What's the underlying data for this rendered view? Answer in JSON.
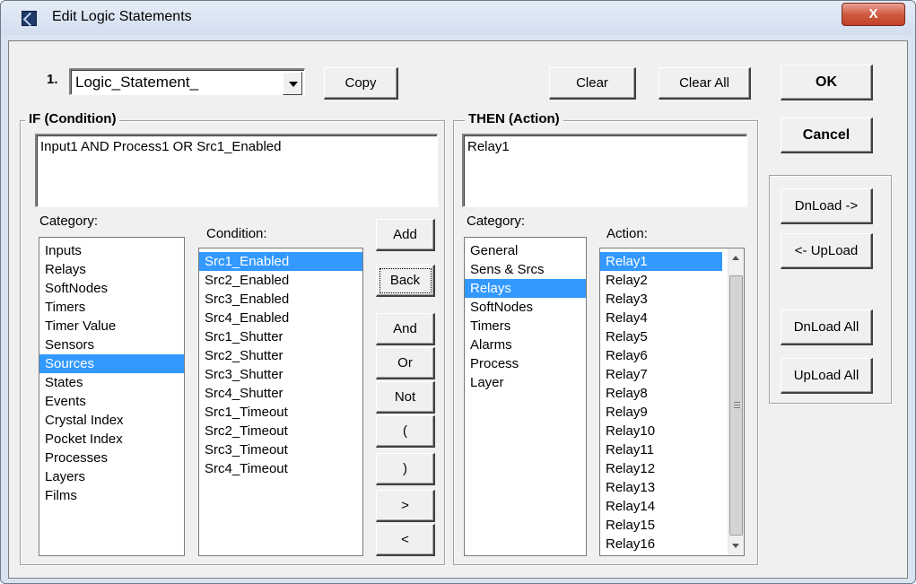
{
  "window": {
    "title": "Edit Logic Statements",
    "close_label": "X"
  },
  "top": {
    "statement_number": "1.",
    "statement_value": "Logic_Statement_",
    "copy_label": "Copy",
    "clear_label": "Clear",
    "clear_all_label": "Clear All",
    "ok_label": "OK",
    "cancel_label": "Cancel"
  },
  "if_group": {
    "legend": "IF (Condition)",
    "text": "Input1 AND Process1 OR Src1_Enabled",
    "category_label": "Category:",
    "categories": [
      "Inputs",
      "Relays",
      "SoftNodes",
      "Timers",
      "Timer Value",
      "Sensors",
      "Sources",
      "States",
      "Events",
      "Crystal Index",
      "Pocket Index",
      "Processes",
      "Layers",
      "Films"
    ],
    "category_selected": "Sources",
    "condition_label": "Condition:",
    "conditions": [
      "Src1_Enabled",
      "Src2_Enabled",
      "Src3_Enabled",
      "Src4_Enabled",
      "Src1_Shutter",
      "Src2_Shutter",
      "Src3_Shutter",
      "Src4_Shutter",
      "Src1_Timeout",
      "Src2_Timeout",
      "Src3_Timeout",
      "Src4_Timeout"
    ],
    "condition_selected": "Src1_Enabled"
  },
  "operators": {
    "add": "Add",
    "back": "Back",
    "and": "And",
    "or": "Or",
    "not": "Not",
    "open_paren": "(",
    "close_paren": ")",
    "gt": ">",
    "lt": "<"
  },
  "then_group": {
    "legend": "THEN (Action)",
    "text": "Relay1",
    "category_label": "Category:",
    "categories": [
      "General",
      "Sens & Srcs",
      "Relays",
      "SoftNodes",
      "Timers",
      "Alarms",
      "Process",
      "Layer"
    ],
    "category_selected": "Relays",
    "action_label": "Action:",
    "actions": [
      "Relay1",
      "Relay2",
      "Relay3",
      "Relay4",
      "Relay5",
      "Relay6",
      "Relay7",
      "Relay8",
      "Relay9",
      "Relay10",
      "Relay11",
      "Relay12",
      "Relay13",
      "Relay14",
      "Relay15",
      "Relay16"
    ],
    "action_selected": "Relay1"
  },
  "transfer": {
    "download": "DnLoad ->",
    "upload": "<- UpLoad",
    "download_all": "DnLoad All",
    "upload_all": "UpLoad All"
  }
}
